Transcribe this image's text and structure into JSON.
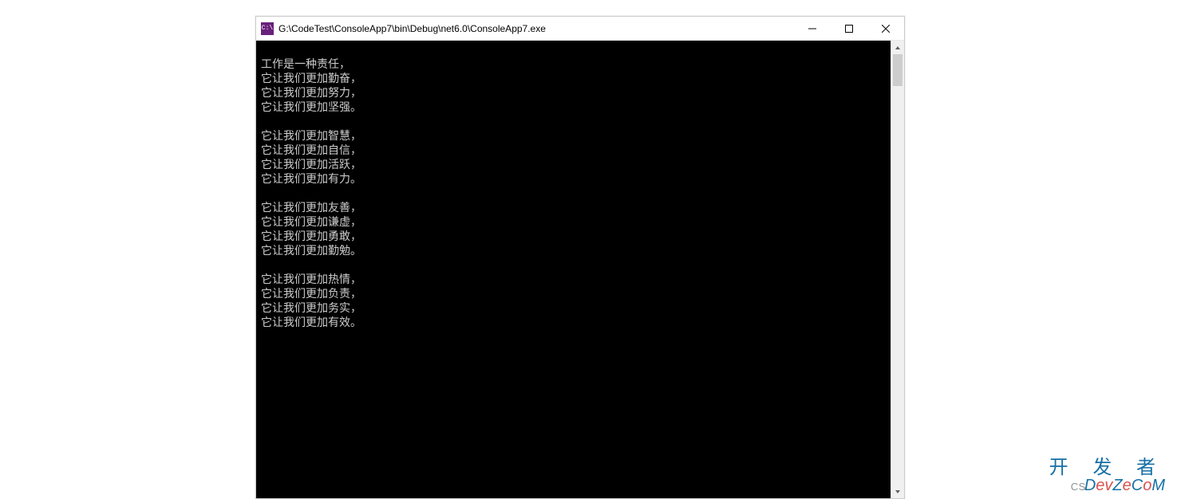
{
  "window": {
    "icon_label": "C:\\",
    "title": "G:\\CodeTest\\ConsoleApp7\\bin\\Debug\\net6.0\\ConsoleApp7.exe"
  },
  "console": {
    "lines": [
      "",
      "工作是一种责任，",
      "它让我们更加勤奋，",
      "它让我们更加努力，",
      "它让我们更加坚强。",
      "",
      "它让我们更加智慧，",
      "它让我们更加自信，",
      "它让我们更加活跃，",
      "它让我们更加有力。",
      "",
      "它让我们更加友善，",
      "它让我们更加谦虚，",
      "它让我们更加勇敢，",
      "它让我们更加勤勉。",
      "",
      "它让我们更加热情，",
      "它让我们更加负责，",
      "它让我们更加务实，",
      "它让我们更加有效。"
    ]
  },
  "watermark": {
    "top": "开 发 者",
    "prefix": "CS",
    "brandA": "D",
    "brandB": "ev",
    "brandC": "Z",
    "brandD": "e",
    "brandE": "C",
    "brandF": "o",
    "brandG": "M"
  }
}
